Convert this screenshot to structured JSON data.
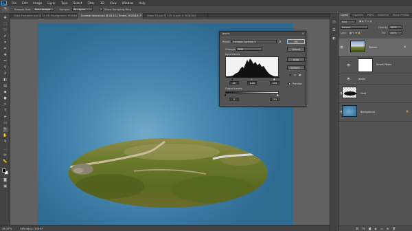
{
  "app": {
    "logo": "Ps",
    "menu": [
      "File",
      "Edit",
      "Image",
      "Layer",
      "Type",
      "Select",
      "Filter",
      "3D",
      "View",
      "Window",
      "Help"
    ]
  },
  "options_bar": {
    "sample_size_label": "Sample Size:",
    "sample_size_value": "Point Sample",
    "sample_label": "Sample:",
    "sample_value": "All Layers",
    "show_ring_label": "Show Sampling Ring"
  },
  "tabs": [
    "Glass Footpoint.psd @ 33.3% (Background, RGB/8#)",
    "Summer Island.psd @ 46.4% (Terrain, RGB/8#) *",
    "Steps 13.psd @ 25% (Layer 0, RGB/8#)"
  ],
  "status": {
    "zoom": "46.47%",
    "info": "Efficiency: 100%*"
  },
  "levels": {
    "title": "Levels",
    "preset_label": "Preset:",
    "preset_value": "Increase Contrast 2",
    "channel_label": "Channel:",
    "channel_value": "RGB",
    "input_label": "Input Levels:",
    "input_values": [
      "20",
      "1.00",
      "235"
    ],
    "output_label": "Output Levels:",
    "output_values": [
      "0",
      "255"
    ],
    "buttons": [
      "OK",
      "Cancel",
      "Auto",
      "Options..."
    ],
    "preview_label": "Preview",
    "preview_checked": true
  },
  "layers_panel": {
    "tabs": [
      "Layers",
      "Channels",
      "Paths",
      "Swatches",
      "Brush Presets"
    ],
    "kind_label": "Kind",
    "blend_mode": "Normal",
    "opacity_label": "Opacity:",
    "opacity_value": "100%",
    "lock_label": "Lock:",
    "fill_label": "Fill:",
    "fill_value": "100%",
    "layers": [
      {
        "name": "Terrain",
        "selected": true
      },
      {
        "name": "Smart Filters",
        "selected": false
      },
      {
        "name": "Levels",
        "selected": false
      },
      {
        "name": "Oval",
        "selected": false
      },
      {
        "name": "Background",
        "selected": false
      }
    ]
  }
}
